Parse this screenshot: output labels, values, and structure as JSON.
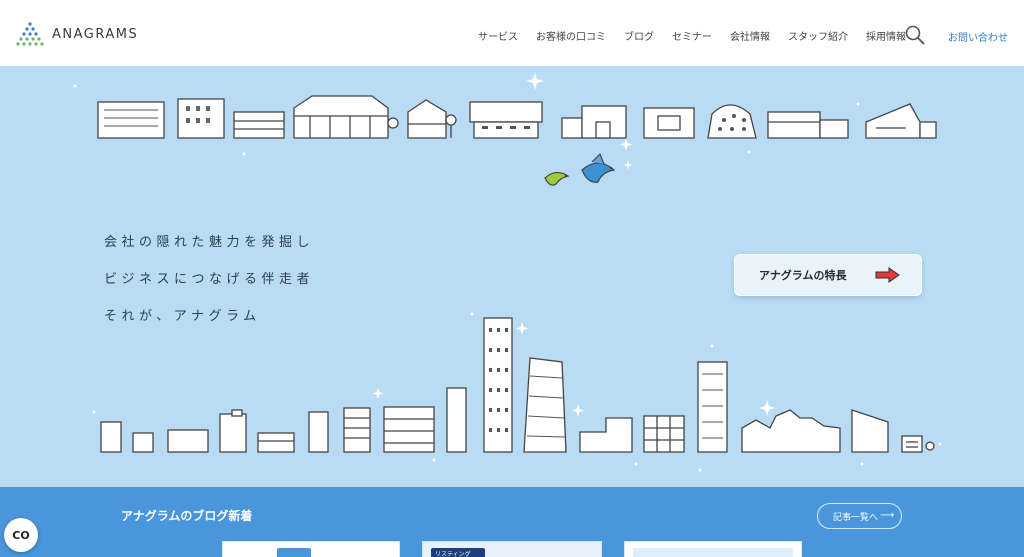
{
  "header": {
    "logo_text": "ANAGRAMS",
    "nav": [
      "サービス",
      "お客様の口コミ",
      "ブログ",
      "セミナー",
      "会社情報",
      "スタッフ紹介",
      "採用情報"
    ],
    "contact_label": "お問い合わせ"
  },
  "hero": {
    "taglines": [
      "会社の隠れた魅力を発掘し",
      "ビジネスにつなげる伴走者",
      "それが、アナグラム"
    ],
    "feature_button_label": "アナグラムの特長"
  },
  "blog": {
    "title": "アナグラムのブログ新着",
    "more_label": "記事一覧へ",
    "card_partial_text": "リスティング"
  },
  "cookie_label": "CO",
  "colors": {
    "sky": "#b9dcf4",
    "blog_band": "#4a96dc",
    "contact": "#2f7fcf",
    "arrow": "#e03a3a"
  }
}
